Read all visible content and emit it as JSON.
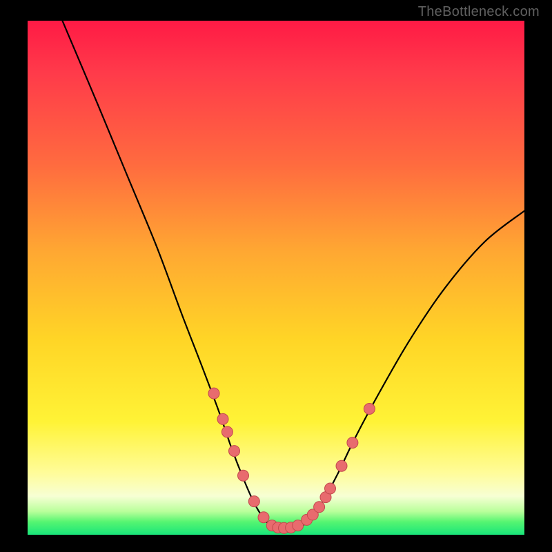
{
  "watermark": "TheBottleneck.com",
  "colors": {
    "curve": "#000000",
    "marker_fill": "#e86b6e",
    "marker_stroke": "#c24a4d"
  },
  "chart_data": {
    "type": "line",
    "title": "",
    "xlabel": "",
    "ylabel": "",
    "xlim": [
      0,
      100
    ],
    "ylim": [
      0,
      100
    ],
    "curve": [
      [
        7,
        100
      ],
      [
        14,
        84
      ],
      [
        20,
        70
      ],
      [
        26,
        56
      ],
      [
        31,
        43
      ],
      [
        35,
        33
      ],
      [
        38.5,
        24
      ],
      [
        41,
        17
      ],
      [
        43.4,
        11
      ],
      [
        45.6,
        6.2
      ],
      [
        47.5,
        3.2
      ],
      [
        49.2,
        1.6
      ],
      [
        51,
        1.2
      ],
      [
        53,
        1.2
      ],
      [
        55,
        1.6
      ],
      [
        57,
        3.2
      ],
      [
        59.5,
        6.6
      ],
      [
        62.5,
        12
      ],
      [
        66,
        19
      ],
      [
        71,
        28
      ],
      [
        77,
        38
      ],
      [
        84,
        48
      ],
      [
        92,
        57
      ],
      [
        100,
        63
      ]
    ],
    "markers": [
      [
        37.5,
        27.5
      ],
      [
        39.3,
        22.5
      ],
      [
        40.2,
        20.0
      ],
      [
        41.6,
        16.3
      ],
      [
        43.4,
        11.5
      ],
      [
        45.6,
        6.5
      ],
      [
        47.5,
        3.4
      ],
      [
        49.2,
        1.8
      ],
      [
        50.4,
        1.4
      ],
      [
        51.6,
        1.3
      ],
      [
        53.0,
        1.4
      ],
      [
        54.4,
        1.8
      ],
      [
        56.2,
        2.9
      ],
      [
        57.4,
        3.9
      ],
      [
        58.7,
        5.4
      ],
      [
        60.0,
        7.3
      ],
      [
        60.9,
        9.0
      ],
      [
        63.2,
        13.4
      ],
      [
        65.4,
        17.9
      ],
      [
        68.8,
        24.5
      ]
    ],
    "marker_radius": 8
  }
}
